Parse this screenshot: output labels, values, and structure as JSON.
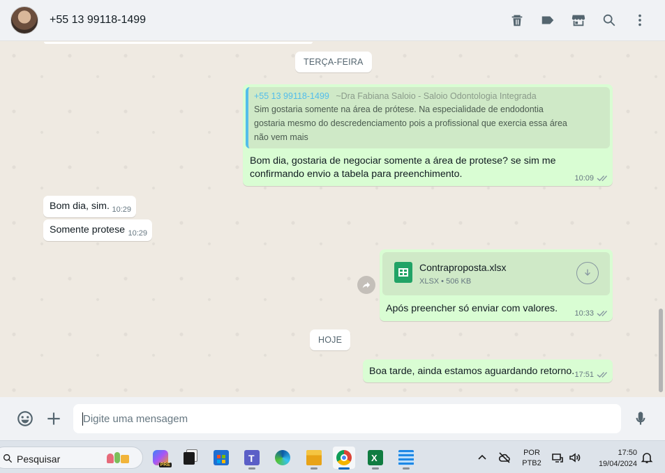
{
  "header": {
    "contact_name": "+55 13 99118-1499",
    "actions": [
      "trash-icon",
      "label-icon",
      "store-icon",
      "search-icon",
      "menu-icon"
    ]
  },
  "chat": {
    "day_separators": [
      "TERÇA-FEIRA",
      "HOJE"
    ],
    "messages": [
      {
        "direction": "out",
        "quote": {
          "author": "+55 13 99118-1499",
          "author_sub": "~Dra Fabiana Saloio - Saloio Odontologia Integrada",
          "text": "Sim gostaria somente na área de prótese. Na especialidade de endodontia gostaria mesmo do descredenciamento pois a profissional que exercia essa área não vem mais"
        },
        "text": "Bom dia, gostaria de negociar somente a área de protese? se sim me confirmando envio a tabela para preenchimento.",
        "time": "10:09"
      },
      {
        "direction": "in",
        "text": "Bom dia, sim.",
        "time": "10:29"
      },
      {
        "direction": "in",
        "text": "Somente protese",
        "time": "10:29"
      },
      {
        "direction": "out",
        "file": {
          "name": "Contraproposta.xlsx",
          "info": "XLSX • 506 KB"
        },
        "text": "Após preencher só enviar com valores.",
        "time": "10:33"
      },
      {
        "direction": "out",
        "text": "Boa tarde, ainda estamos aguardando retorno.",
        "time": "17:51"
      }
    ]
  },
  "composer": {
    "placeholder": "Digite uma mensagem"
  },
  "taskbar": {
    "search_label": "Pesquisar",
    "apps": [
      "copilot-icon",
      "task-view-icon",
      "store-icon",
      "teams-icon",
      "edge-icon",
      "file-explorer-icon",
      "chrome-icon",
      "excel-icon",
      "notepad-icon"
    ],
    "language_line1": "POR",
    "language_line2": "PTB2",
    "time": "17:50",
    "date": "19/04/2024"
  },
  "colors": {
    "outgoing_bubble": "#d9fdd3",
    "incoming_bubble": "#ffffff",
    "chat_background": "#efeae2",
    "quote_accent": "#53bdeb"
  }
}
